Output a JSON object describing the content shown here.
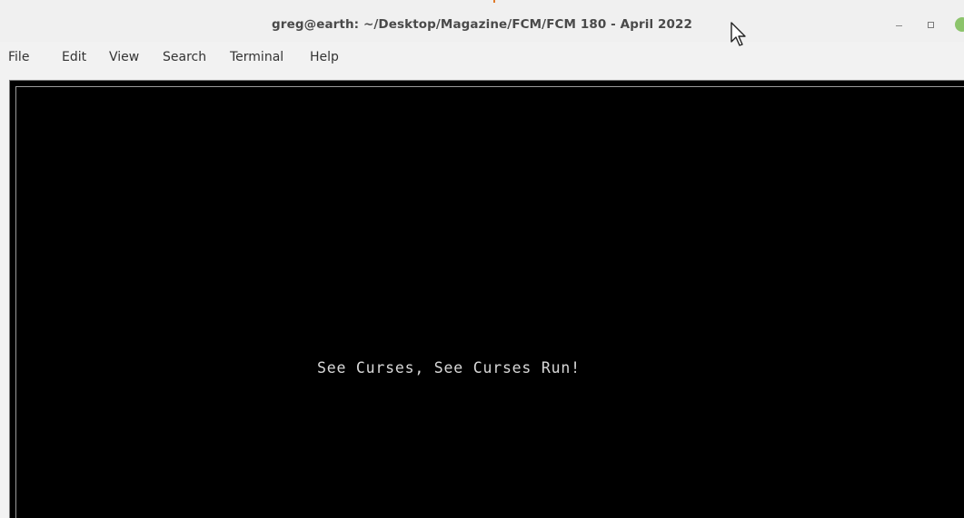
{
  "window": {
    "title": "greg@earth: ~/Desktop/Magazine/FCM/FCM 180 - April 2022",
    "controls": {
      "minimize_icon": "minimize-icon",
      "maximize_icon": "maximize-icon",
      "close_icon": "close-icon"
    }
  },
  "menu": {
    "items": [
      "File",
      "Edit",
      "View",
      "Search",
      "Terminal",
      "Help"
    ]
  },
  "terminal": {
    "background": "#000000",
    "foreground": "#d8d8d8",
    "output": "See Curses, See Curses Run!"
  },
  "colors": {
    "titlebar": "#f0f0f0",
    "close_button": "#8cc46b"
  }
}
